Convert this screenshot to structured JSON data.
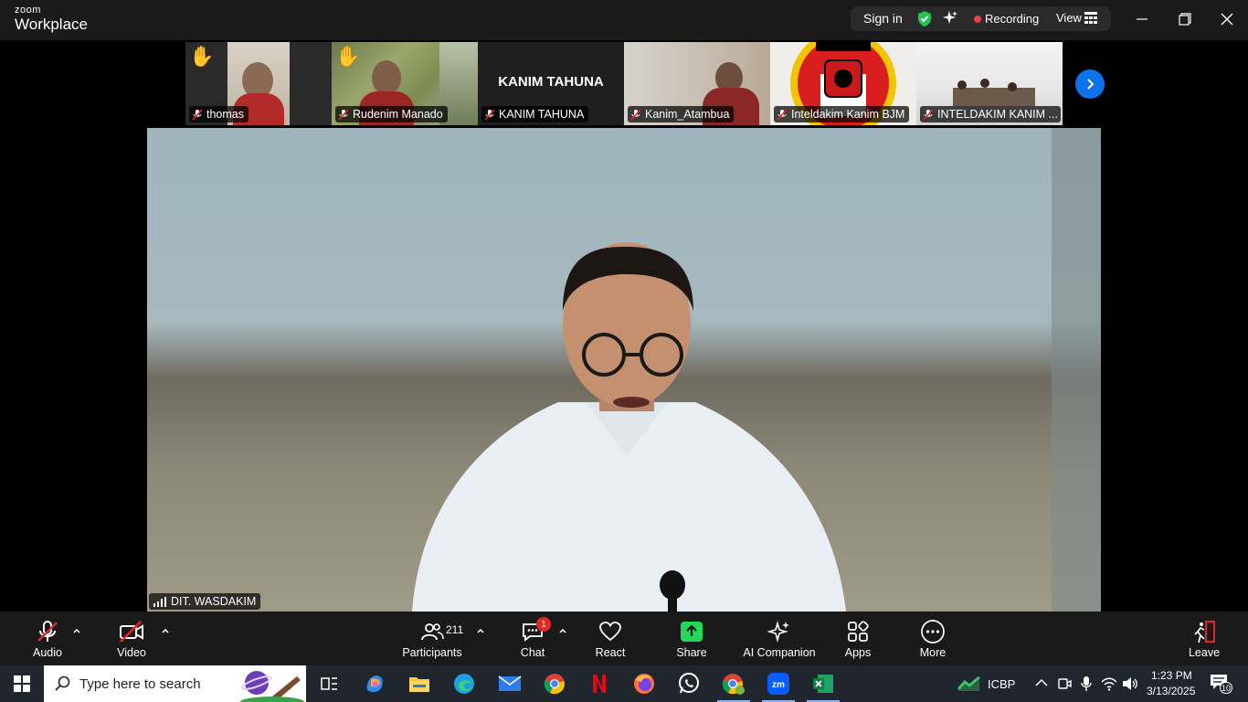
{
  "titlebar": {
    "brand_small": "zoom",
    "brand_big": "Workplace",
    "sign_in": "Sign in",
    "recording": "Recording",
    "view": "View"
  },
  "thumbnails": [
    {
      "name": "thomas",
      "hand_raised": true,
      "muted": true
    },
    {
      "name": "Rudenim Manado",
      "hand_raised": true,
      "muted": true
    },
    {
      "name": "KANIM TAHUNA",
      "title_text": "KANIM TAHUNA",
      "hand_raised": false,
      "muted": true
    },
    {
      "name": "Kanim_Atambua",
      "hand_raised": false,
      "muted": true
    },
    {
      "name": "Inteldakim Kanim BJM",
      "hand_raised": false,
      "muted": true
    },
    {
      "name": "INTELDAKIM KANIM ...",
      "hand_raised": false,
      "muted": true
    }
  ],
  "speaker": {
    "name": "DIT. WASDAKIM"
  },
  "controls": {
    "audio": "Audio",
    "video": "Video",
    "participants": "Participants",
    "participants_count": "211",
    "chat": "Chat",
    "chat_badge": "1",
    "react": "React",
    "share": "Share",
    "ai_companion": "AI Companion",
    "apps": "Apps",
    "more": "More",
    "leave": "Leave"
  },
  "taskbar": {
    "search_placeholder": "Type here to search",
    "stock_label": "ICBP",
    "time": "1:23 PM",
    "date": "3/13/2025",
    "notification_count": "10"
  },
  "colors": {
    "accent_blue": "#0e72ed",
    "recording_red": "#f14040",
    "share_green": "#23d959",
    "muted_red": "#e02828"
  }
}
